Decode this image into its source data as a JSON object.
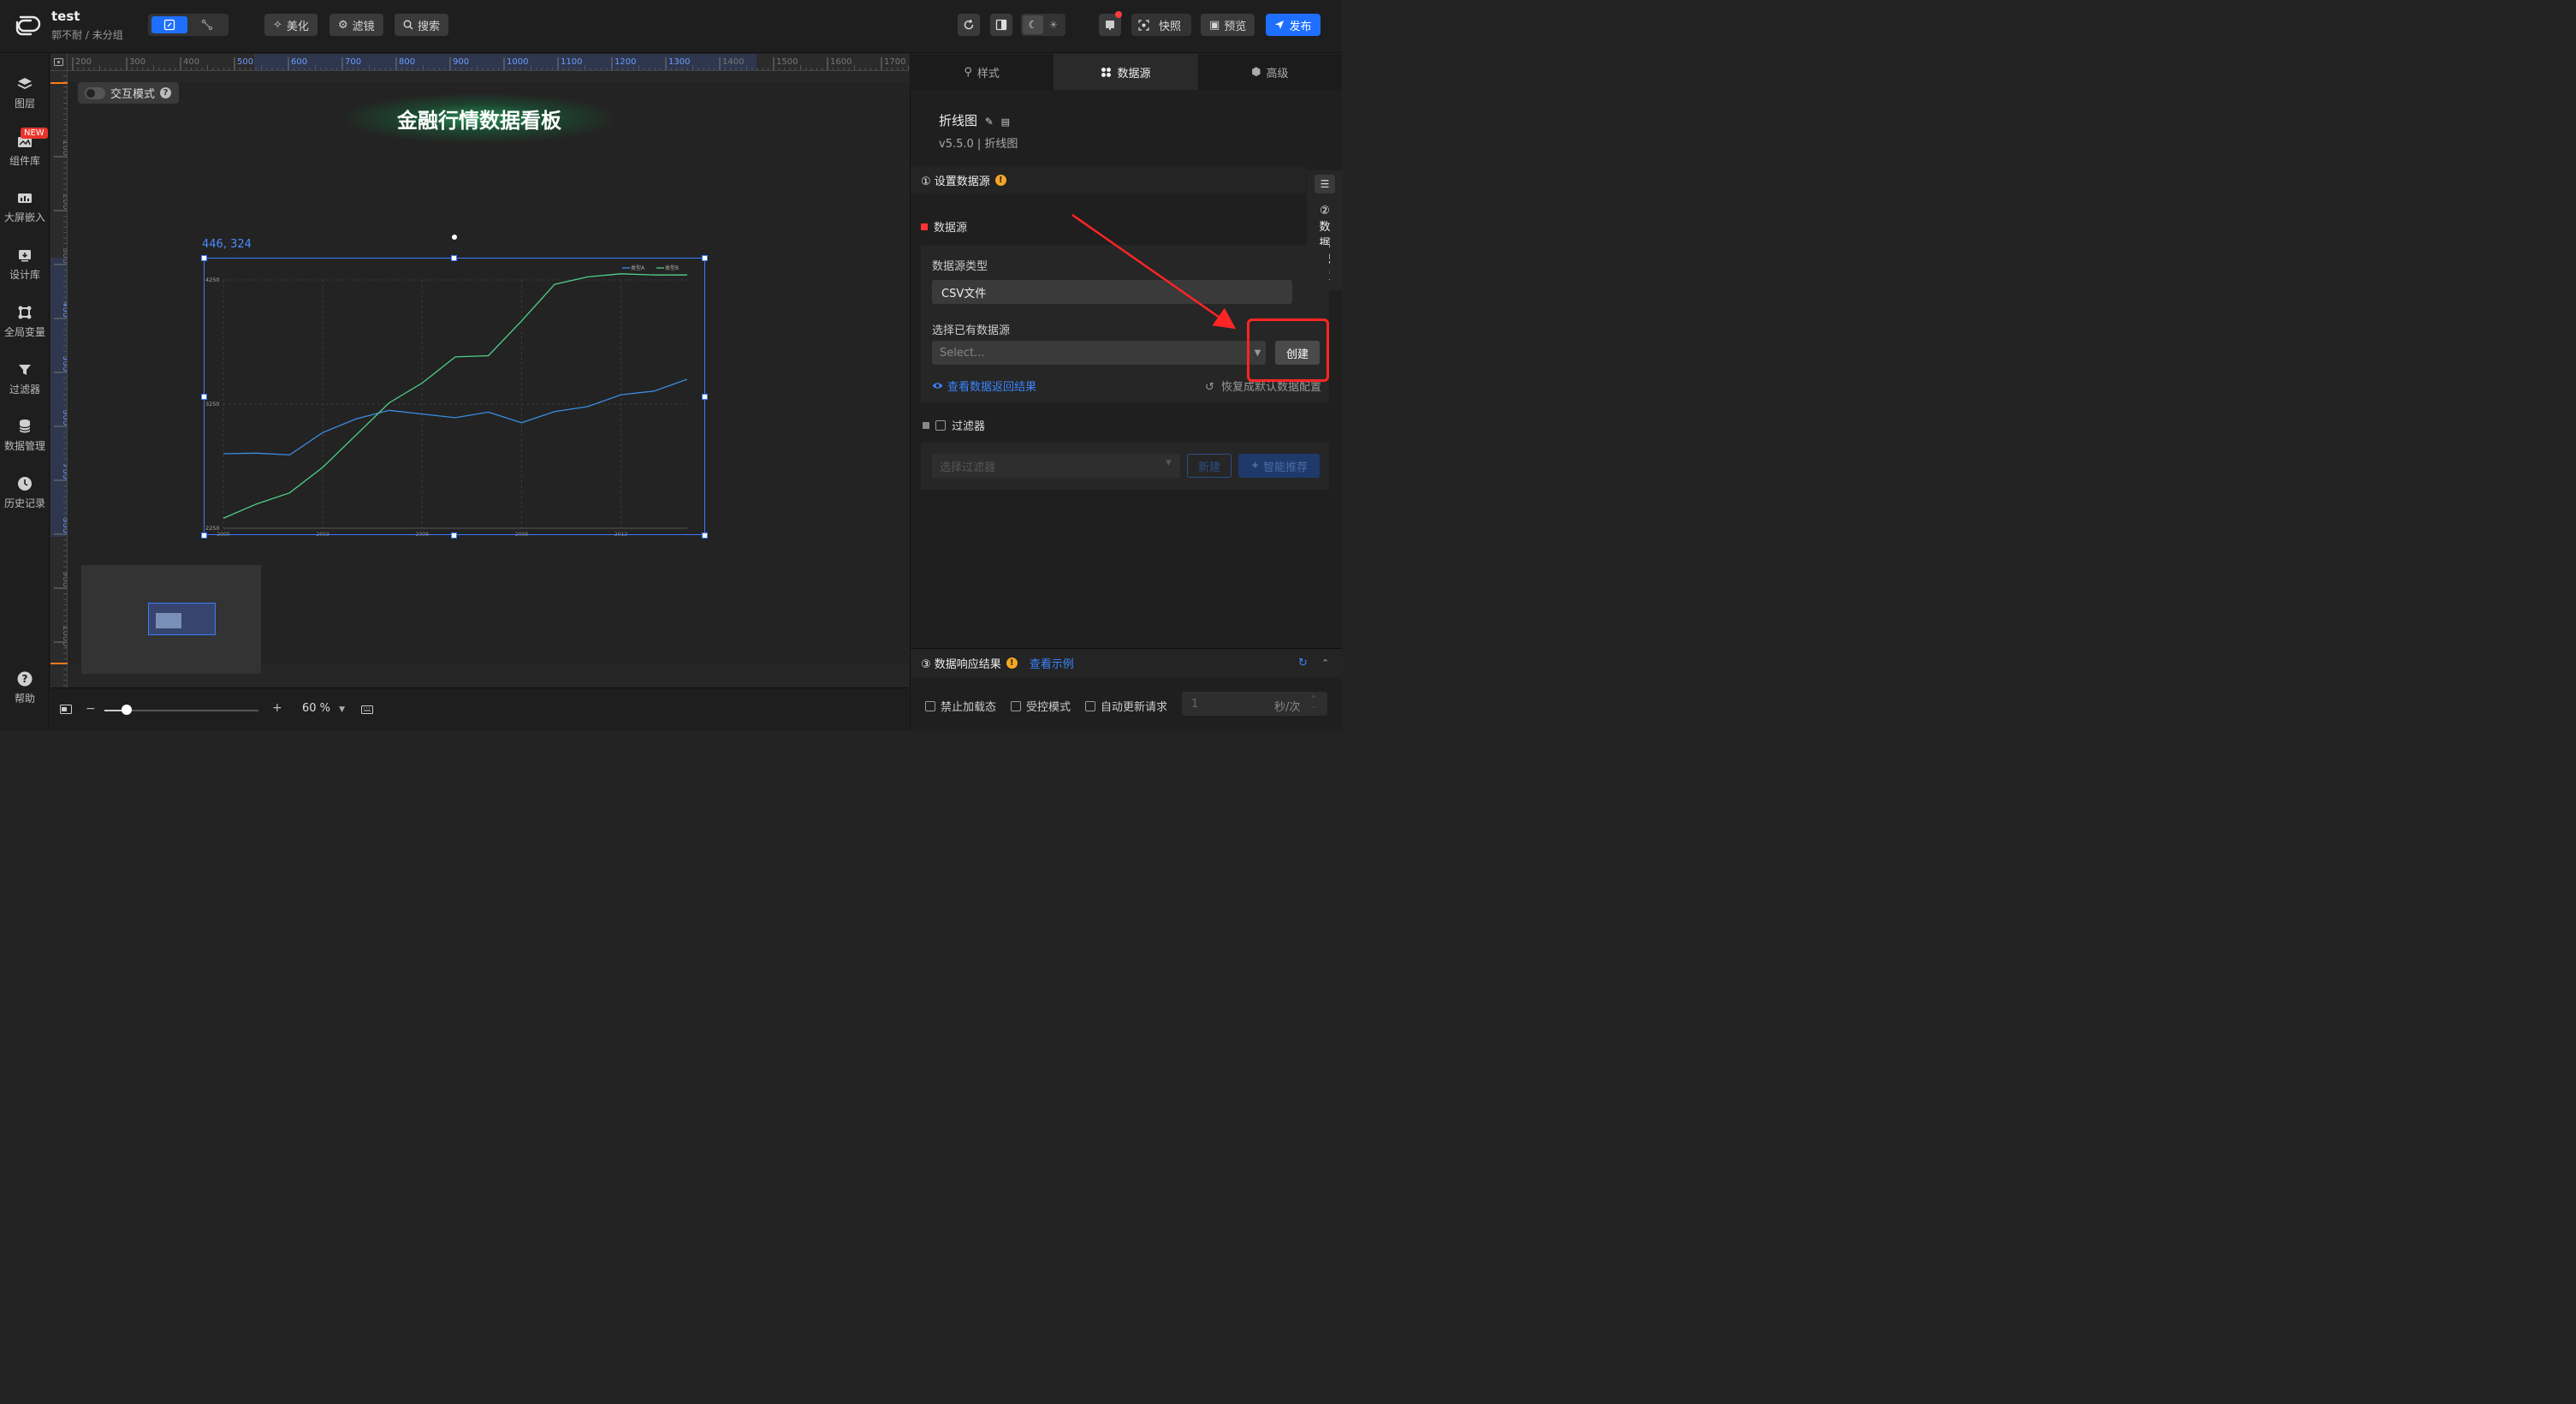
{
  "header": {
    "project_title": "test",
    "author": "郭不耐",
    "separator": "/",
    "group": "未分组",
    "beautify_label": "美化",
    "filter_label": "滤镜",
    "search_label": "搜索",
    "snapshot_label": "快照",
    "preview_label": "预览",
    "publish_label": "发布"
  },
  "sidebar": {
    "items": [
      {
        "label": "图层",
        "icon": "layers-icon"
      },
      {
        "label": "组件库",
        "icon": "component-library-icon"
      },
      {
        "label": "大屏嵌入",
        "icon": "screen-embed-icon"
      },
      {
        "label": "设计库",
        "icon": "design-library-icon"
      },
      {
        "label": "全局变量",
        "icon": "global-variable-icon"
      },
      {
        "label": "过滤器",
        "icon": "funnel-icon"
      },
      {
        "label": "数据管理",
        "icon": "database-icon"
      },
      {
        "label": "历史记录",
        "icon": "clock-icon"
      }
    ],
    "new_badge": "NEW",
    "help_label": "帮助"
  },
  "ruler": {
    "horizontal_ticks": [
      "200",
      "300",
      "400",
      "500",
      "600",
      "700",
      "800",
      "900",
      "1000",
      "1100",
      "1200",
      "1300",
      "1400",
      "1500",
      "1600",
      "1700"
    ],
    "vertical_ticks": [
      "100",
      "200",
      "300",
      "400",
      "500",
      "600",
      "700",
      "800",
      "900",
      "1000"
    ]
  },
  "canvas": {
    "interact_mode_label": "交互模式",
    "board_title": "金融行情数据看板",
    "selection_coord": "446, 324"
  },
  "chart_data": {
    "type": "line",
    "x": [
      2000,
      2001,
      2002,
      2003,
      2004,
      2005,
      2006,
      2007,
      2008,
      2009,
      2010,
      2011,
      2012,
      2013,
      2014
    ],
    "x_tick_labels": [
      "2000",
      "2003",
      "2006",
      "2009",
      "2012"
    ],
    "y_tick_labels": [
      "4250",
      "3250",
      "2250"
    ],
    "ylim": [
      2250,
      4250
    ],
    "series": [
      {
        "name": "类型A",
        "color": "#3a8de0",
        "values": [
          2850,
          2855,
          2840,
          3020,
          3130,
          3200,
          3170,
          3140,
          3185,
          3100,
          3190,
          3230,
          3325,
          3355,
          3450
        ]
      },
      {
        "name": "类型B",
        "color": "#4fd08a",
        "values": [
          2330,
          2445,
          2535,
          2740,
          3000,
          3260,
          3420,
          3630,
          3640,
          3920,
          4215,
          4275,
          4300,
          4290,
          4290
        ]
      }
    ],
    "legend": "top-right",
    "grid": true
  },
  "bottombar": {
    "zoom_minus": "−",
    "zoom_plus": "+",
    "zoom_level": "60 %",
    "zoom_fraction": 0.6
  },
  "right_panel": {
    "tabs": [
      {
        "label": "样式",
        "icon": "style-icon"
      },
      {
        "label": "数据源",
        "icon": "datasource-icon"
      },
      {
        "label": "高级",
        "icon": "advanced-icon"
      }
    ],
    "component_name": "折线图",
    "component_version": "v5.5.0 | 折线图",
    "section1_title": "① 设置数据源",
    "datasource_label": "数据源",
    "datasource_type_label": "数据源类型",
    "datasource_type_value": "CSV文件",
    "existing_source_label": "选择已有数据源",
    "select_placeholder": "Select...",
    "create_button": "创建",
    "view_result_link": "查看数据返回结果",
    "restore_default": "恢复成默认数据配置",
    "filter_label": "过滤器",
    "filter_select_placeholder": "选择过滤器",
    "new_button": "新建",
    "smart_recommend_button": "智能推荐",
    "side_tab_number": "②",
    "side_tab_text": [
      "数",
      "据",
      "配",
      "置"
    ],
    "response_title": "③ 数据响应结果",
    "view_example_link": "查看示例",
    "options": [
      "禁止加载态",
      "受控模式",
      "自动更新请求"
    ],
    "interval_value": "1",
    "interval_unit": "秒/次"
  }
}
